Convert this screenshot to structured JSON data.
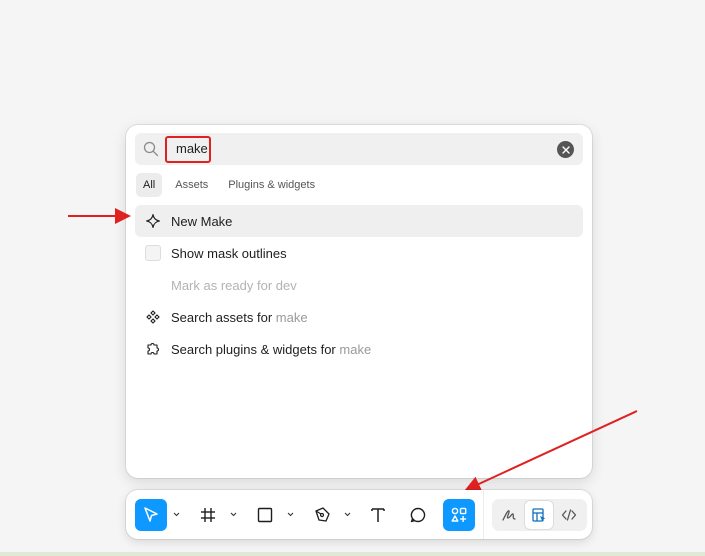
{
  "search": {
    "value": "make",
    "placeholder": ""
  },
  "tabs": [
    {
      "label": "All",
      "active": true
    },
    {
      "label": "Assets",
      "active": false
    },
    {
      "label": "Plugins & widgets",
      "active": false
    }
  ],
  "results": {
    "new_make": {
      "label": "New Make",
      "icon": "new-make-icon"
    },
    "mask_outlines": {
      "label": "Show mask outlines",
      "icon": "checkbox"
    },
    "ready_for_dev": {
      "label": "Mark as ready for dev"
    },
    "search_assets": {
      "prefix": "Search assets for",
      "term": "make",
      "icon": "assets-icon"
    },
    "search_plugins": {
      "prefix": "Search plugins & widgets for",
      "term": "make",
      "icon": "plugin-icon"
    }
  },
  "toolbar": {
    "tools": [
      "move-tool",
      "frame-tool",
      "rectangle-tool",
      "pen-tool",
      "text-tool",
      "comment-tool",
      "actions-tool"
    ],
    "active_tool": "actions-tool",
    "modes": [
      "draw-mode",
      "design-mode",
      "dev-mode"
    ],
    "active_mode": "design-mode"
  },
  "colors": {
    "accent": "#0d99ff",
    "annotation": "#e02121"
  }
}
